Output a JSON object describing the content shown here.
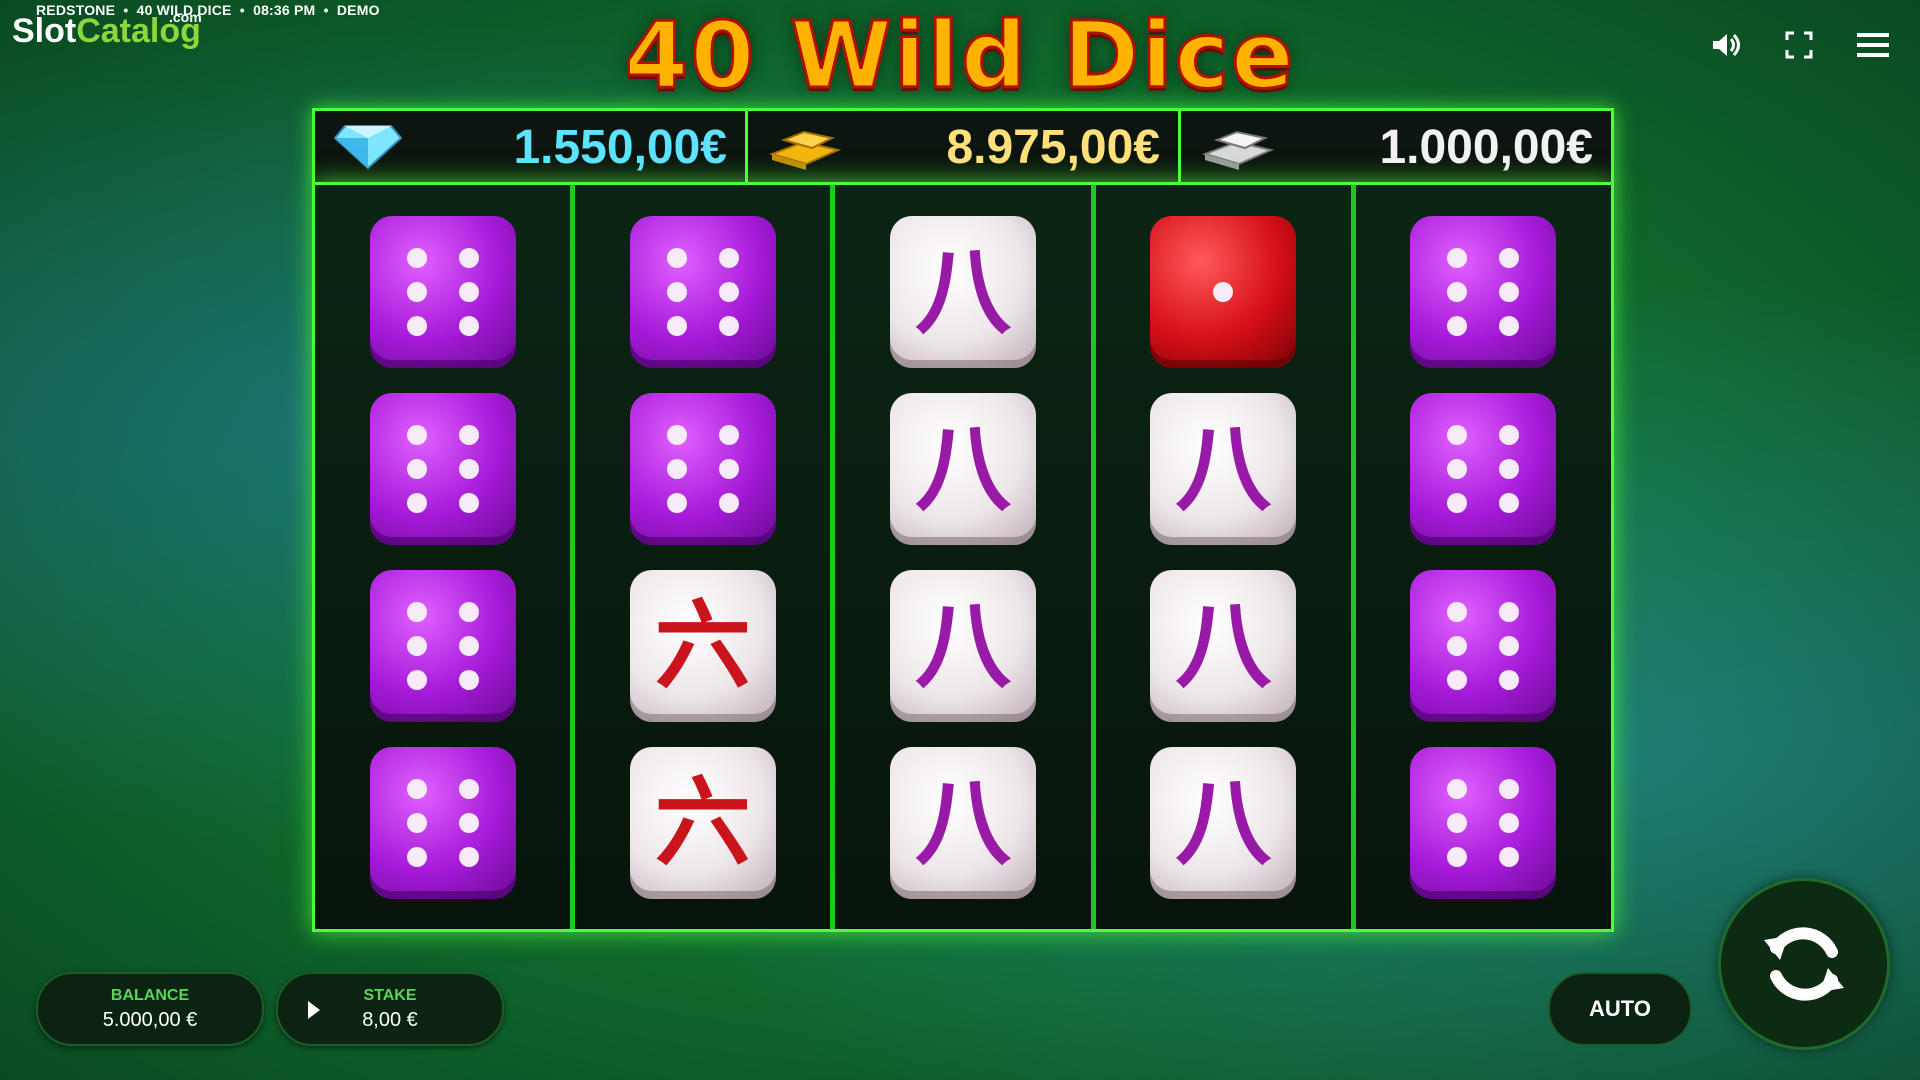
{
  "topbar": {
    "provider": "REDSTONE",
    "game": "40 WILD DICE",
    "time": "08:36 PM",
    "mode": "DEMO",
    "separator": "•"
  },
  "logo": {
    "part1": "Slot",
    "part2": "Catalog",
    "suffix": ".com"
  },
  "title": "40 Wild Dice",
  "icons": {
    "sound": "speaker-icon",
    "fullscreen": "fullscreen-icon",
    "menu": "hamburger-menu-icon"
  },
  "jackpots": [
    {
      "icon": "diamond-icon",
      "value": "1.550,00€"
    },
    {
      "icon": "gold-bars-icon",
      "value": "8.975,00€"
    },
    {
      "icon": "silver-bars-icon",
      "value": "1.000,00€"
    }
  ],
  "reels": [
    [
      {
        "type": "purple",
        "pips": 6
      },
      {
        "type": "purple",
        "pips": 6
      },
      {
        "type": "purple",
        "pips": 6
      },
      {
        "type": "purple",
        "pips": 6
      }
    ],
    [
      {
        "type": "purple",
        "pips": 6
      },
      {
        "type": "purple",
        "pips": 6
      },
      {
        "type": "kanji",
        "char": "六",
        "color": "red"
      },
      {
        "type": "kanji",
        "char": "六",
        "color": "red"
      }
    ],
    [
      {
        "type": "kanji",
        "char": "八",
        "color": "purple"
      },
      {
        "type": "kanji",
        "char": "八",
        "color": "purple"
      },
      {
        "type": "kanji",
        "char": "八",
        "color": "purple"
      },
      {
        "type": "kanji",
        "char": "八",
        "color": "purple"
      }
    ],
    [
      {
        "type": "red",
        "pips": 1
      },
      {
        "type": "kanji",
        "char": "八",
        "color": "purple"
      },
      {
        "type": "kanji",
        "char": "八",
        "color": "purple"
      },
      {
        "type": "kanji",
        "char": "八",
        "color": "purple"
      }
    ],
    [
      {
        "type": "purple",
        "pips": 6
      },
      {
        "type": "purple",
        "pips": 6
      },
      {
        "type": "purple",
        "pips": 6
      },
      {
        "type": "purple",
        "pips": 6
      }
    ]
  ],
  "balance": {
    "label": "BALANCE",
    "value": "5.000,00 €"
  },
  "stake": {
    "label": "STAKE",
    "value": "8,00 €"
  },
  "auto_label": "AUTO",
  "colors": {
    "accent_green": "#4cff3c",
    "label_green": "#58d65a",
    "title_orange": "#ffb300"
  }
}
